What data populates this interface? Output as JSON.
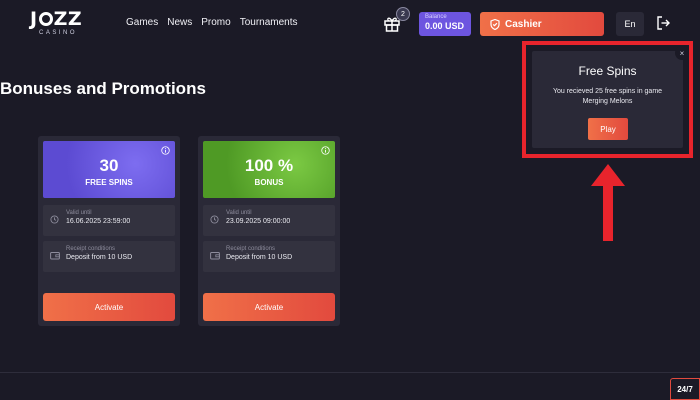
{
  "header": {
    "logo": {
      "word_left": "J",
      "word_right": "ZZ",
      "sub": "CASINO"
    },
    "nav": [
      "Games",
      "News",
      "Promo",
      "Tournaments"
    ],
    "gift_badge": "2",
    "balance": {
      "label": "Balance",
      "value": "0.00 USD"
    },
    "cashier_label": "Cashier",
    "language": "En"
  },
  "page": {
    "title": "Bonuses and Promotions"
  },
  "cards": [
    {
      "headline": "30",
      "subline": "FREE SPINS",
      "valid_label": "Valid until",
      "valid_value": "16.06.2025 23:59:00",
      "receipt_label": "Receipt conditions",
      "receipt_value": "Deposit from 10 USD",
      "button": "Activate"
    },
    {
      "headline": "100 %",
      "subline": "BONUS",
      "valid_label": "Valid until",
      "valid_value": "23.09.2025 09:00:00",
      "receipt_label": "Receipt conditions",
      "receipt_value": "Deposit from 10 USD",
      "button": "Activate"
    }
  ],
  "popup": {
    "title": "Free Spins",
    "message": "You recieved 25 free spins in game Merging Melons",
    "button": "Play",
    "close": "×"
  },
  "support_tab": "24/7",
  "colors": {
    "background": "#1b1a26",
    "card": "#2a2937",
    "accent": "#ea5a42",
    "balance": "#6d55e0",
    "highlight": "#e8242c"
  }
}
